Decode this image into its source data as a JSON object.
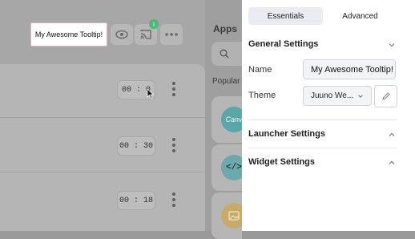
{
  "tooltip": {
    "text": "My Awesome Tooltip!"
  },
  "toolbar": {
    "notification_badge": "i"
  },
  "rows": [
    {
      "time": "00 : 0"
    },
    {
      "time": "00 : 30"
    },
    {
      "time": "00 : 18"
    }
  ],
  "apps": {
    "title": "Apps",
    "popular_label": "Popular",
    "cards": [
      {
        "icon": "canva-icon",
        "color": "#5aa6a9",
        "label": "Canv"
      },
      {
        "icon": "code-icon",
        "color": "#6fa8aa",
        "label": "</>"
      },
      {
        "icon": "image-icon",
        "color": "#c9aa6b"
      }
    ]
  },
  "settings": {
    "tabs": [
      {
        "label": "Essentials",
        "active": true
      },
      {
        "label": "Advanced",
        "active": false
      }
    ],
    "general": {
      "title": "General Settings",
      "name_label": "Name",
      "name_value": "My Awesome Tooltip!",
      "theme_label": "Theme",
      "theme_value": "Juuno We..."
    },
    "launcher": {
      "title": "Launcher Settings"
    },
    "widget": {
      "title": "Widget Settings"
    }
  },
  "colors": {
    "overlay": "#a7a7a7",
    "settings_bg": "#ffffff",
    "active_tab": "#e9ecf2",
    "badge": "#52b57a"
  }
}
